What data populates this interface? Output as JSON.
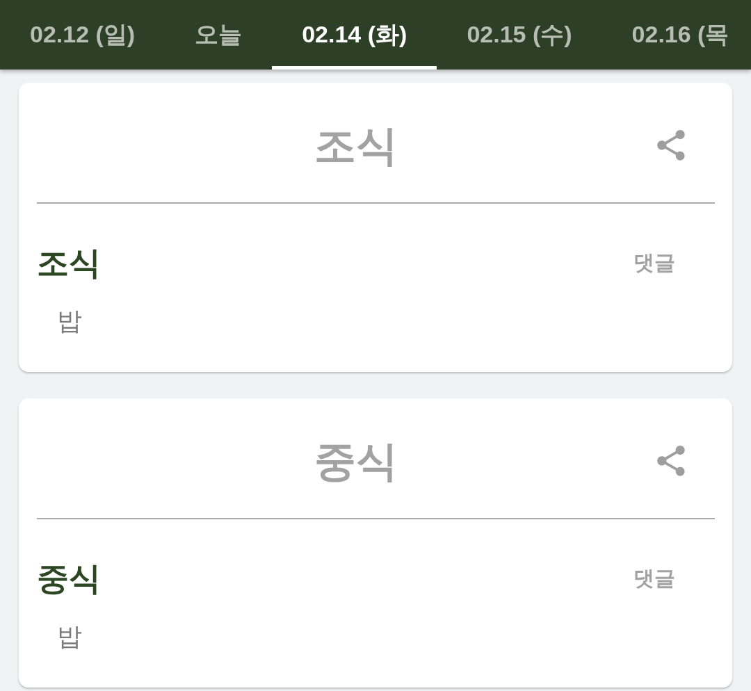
{
  "tabs": [
    {
      "label": "02.12 (일)",
      "selected": false
    },
    {
      "label": "오늘",
      "selected": false
    },
    {
      "label": "02.14 (화)",
      "selected": true
    },
    {
      "label": "02.15 (수)",
      "selected": false
    },
    {
      "label": "02.16 (목",
      "selected": false
    }
  ],
  "meals": [
    {
      "title": "조식",
      "heading": "조식",
      "comment": "댓글",
      "items": [
        "밥"
      ]
    },
    {
      "title": "중식",
      "heading": "중식",
      "comment": "댓글",
      "items": [
        "밥"
      ]
    }
  ]
}
